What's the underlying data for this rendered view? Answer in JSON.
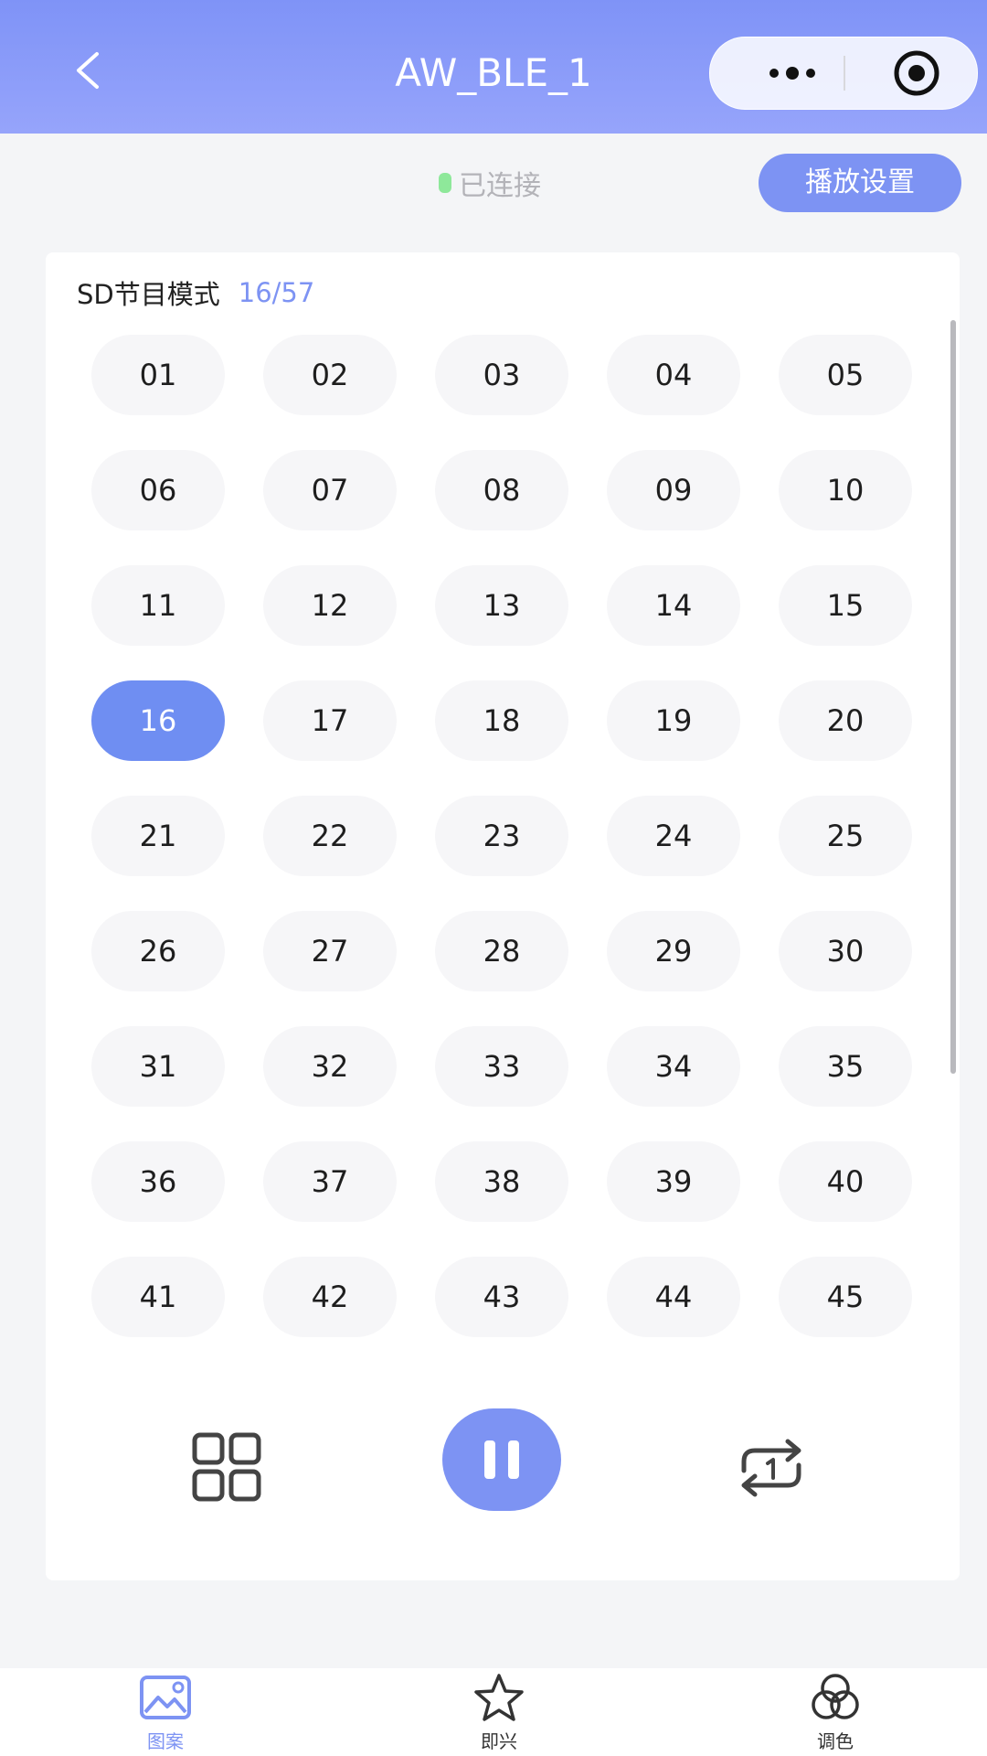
{
  "header": {
    "title": "AW_BLE_1"
  },
  "connection": {
    "status": "已连接"
  },
  "toolbar": {
    "play_settings_label": "播放设置"
  },
  "mode": {
    "label": "SD节目模式",
    "current": 16,
    "total": 57,
    "count_text": "16/57"
  },
  "programs": {
    "items": [
      "01",
      "02",
      "03",
      "04",
      "05",
      "06",
      "07",
      "08",
      "09",
      "10",
      "11",
      "12",
      "13",
      "14",
      "15",
      "16",
      "17",
      "18",
      "19",
      "20",
      "21",
      "22",
      "23",
      "24",
      "25",
      "26",
      "27",
      "28",
      "29",
      "30",
      "31",
      "32",
      "33",
      "34",
      "35",
      "36",
      "37",
      "38",
      "39",
      "40",
      "41",
      "42",
      "43",
      "44",
      "45"
    ],
    "selected": "16"
  },
  "tabs": [
    {
      "label": "图案",
      "icon": "image-icon",
      "active": true
    },
    {
      "label": "即兴",
      "icon": "star-icon",
      "active": false
    },
    {
      "label": "调色",
      "icon": "palette-icon",
      "active": false
    }
  ],
  "colors": {
    "accent": "#7d93f3",
    "header": "#8c9cf9",
    "connected": "#8ee89a"
  }
}
